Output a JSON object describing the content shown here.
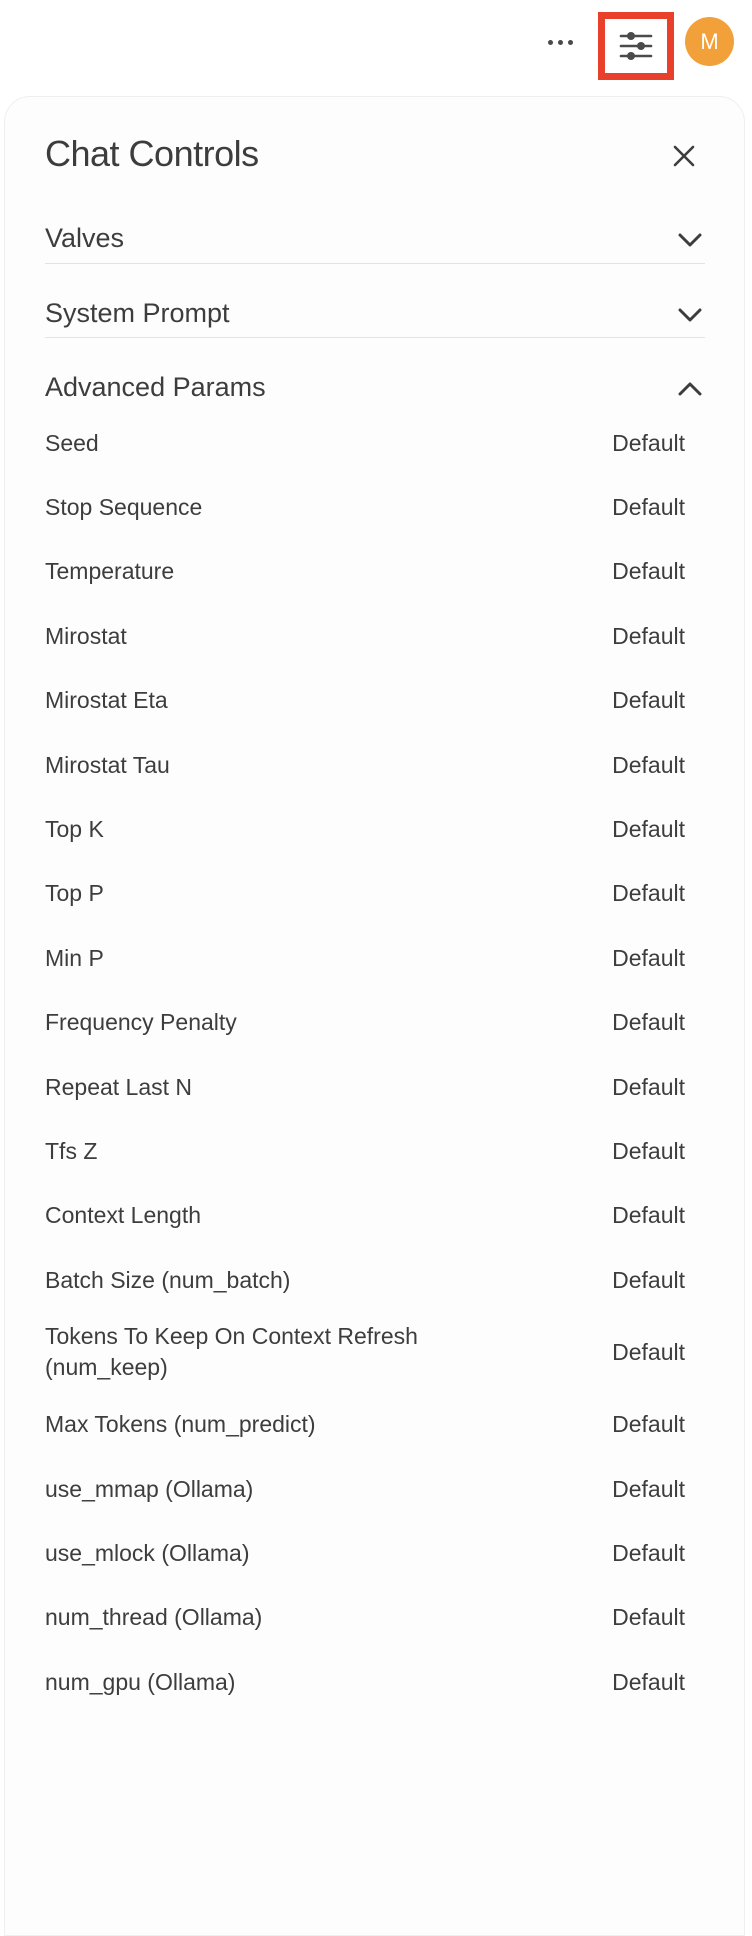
{
  "topbar": {
    "more_icon": "ellipsis-icon",
    "controls_icon": "sliders-icon",
    "avatar_initial": "M",
    "avatar_color": "#f2a13a",
    "highlight_color": "#e8402a"
  },
  "panel": {
    "title": "Chat Controls",
    "close_icon": "close-icon",
    "sections": [
      {
        "label": "Valves",
        "expanded": false
      },
      {
        "label": "System Prompt",
        "expanded": false
      },
      {
        "label": "Advanced Params",
        "expanded": true
      }
    ],
    "params": [
      {
        "name": "Seed",
        "value": "Default"
      },
      {
        "name": "Stop Sequence",
        "value": "Default"
      },
      {
        "name": "Temperature",
        "value": "Default"
      },
      {
        "name": "Mirostat",
        "value": "Default"
      },
      {
        "name": "Mirostat Eta",
        "value": "Default"
      },
      {
        "name": "Mirostat Tau",
        "value": "Default"
      },
      {
        "name": "Top K",
        "value": "Default"
      },
      {
        "name": "Top P",
        "value": "Default"
      },
      {
        "name": "Min P",
        "value": "Default"
      },
      {
        "name": "Frequency Penalty",
        "value": "Default"
      },
      {
        "name": "Repeat Last N",
        "value": "Default"
      },
      {
        "name": "Tfs Z",
        "value": "Default"
      },
      {
        "name": "Context Length",
        "value": "Default"
      },
      {
        "name": "Batch Size (num_batch)",
        "value": "Default"
      },
      {
        "name": "Tokens To Keep On Context Refresh (num_keep)",
        "value": "Default"
      },
      {
        "name": "Max Tokens (num_predict)",
        "value": "Default"
      },
      {
        "name": "use_mmap (Ollama)",
        "value": "Default"
      },
      {
        "name": "use_mlock (Ollama)",
        "value": "Default"
      },
      {
        "name": "num_thread (Ollama)",
        "value": "Default"
      },
      {
        "name": "num_gpu (Ollama)",
        "value": "Default"
      }
    ]
  }
}
